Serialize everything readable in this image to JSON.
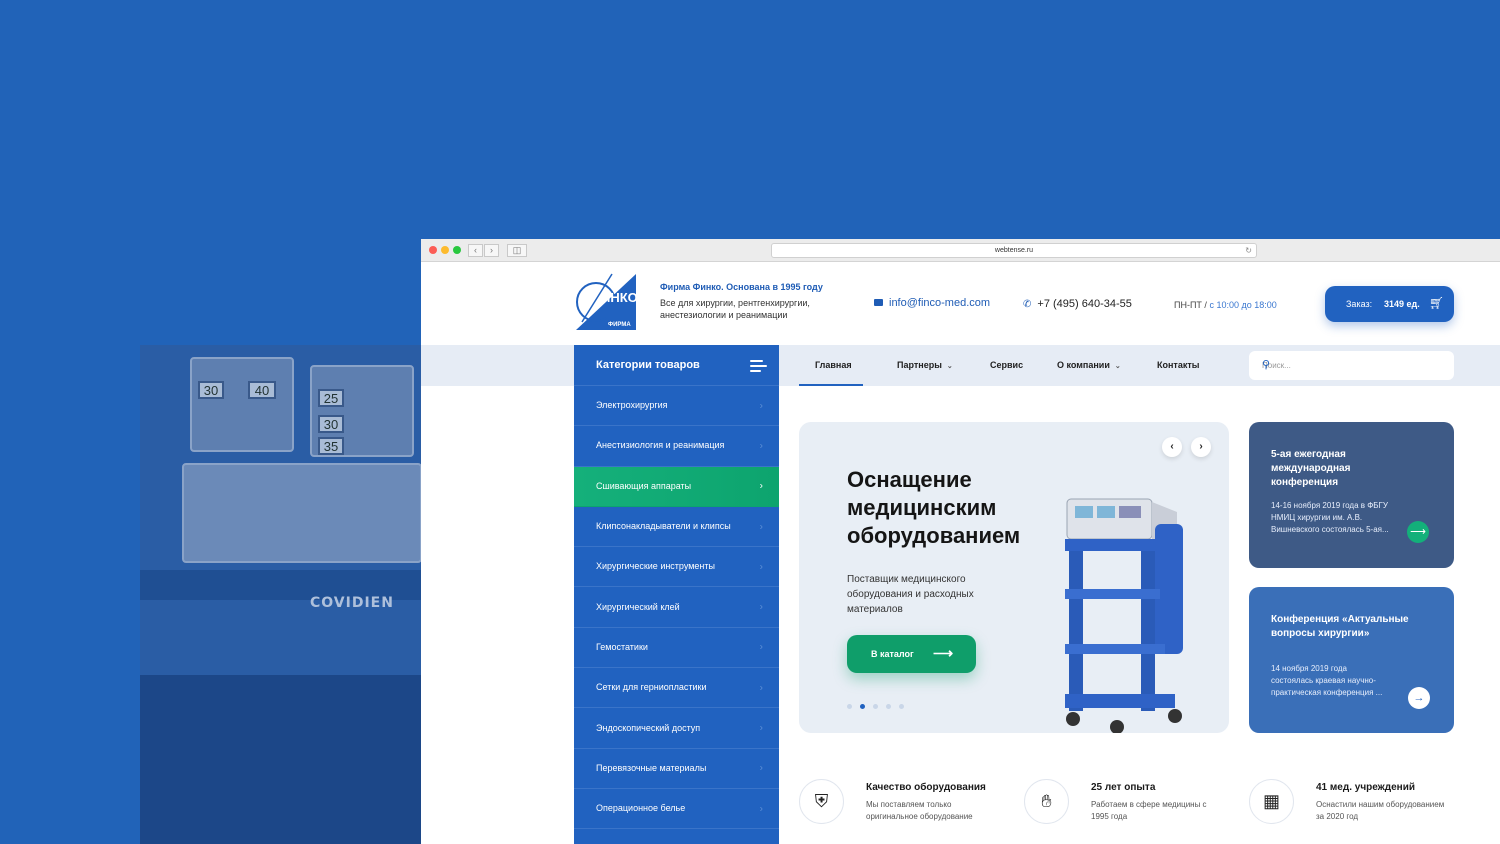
{
  "browser": {
    "url": "webtense.ru"
  },
  "header": {
    "logo_text": "ИНКО",
    "logo_sub": "ФИРМА",
    "firm_title": "Фирма Финко. Основана в 1995 году",
    "firm_desc": "Все для хирургии, рентгенхирургии, анестезиологии и реанимации",
    "email": "info@finco-med.com",
    "phone": "+7 (495) 640-34-55",
    "hours_days": "ПН-ПТ /",
    "hours_time": "с 10:00 до 18:00",
    "order_label": "Заказ:",
    "order_count": "3149 ед."
  },
  "sidebar": {
    "title": "Категории товаров",
    "items": [
      {
        "label": "Электрохирургия"
      },
      {
        "label": "Анестизиология и реанимация"
      },
      {
        "label": "Сшивающия аппараты"
      },
      {
        "label": "Клипсонакладыватели и клипсы"
      },
      {
        "label": "Хирургические инструменты"
      },
      {
        "label": "Хирургический клей"
      },
      {
        "label": "Гемостатики"
      },
      {
        "label": "Сетки для герниопластики"
      },
      {
        "label": "Эндоскопический доступ"
      },
      {
        "label": "Перевязочные материалы"
      },
      {
        "label": "Операционное белье"
      }
    ]
  },
  "nav": {
    "items": [
      {
        "label": "Главная"
      },
      {
        "label": "Партнеры"
      },
      {
        "label": "Сервис"
      },
      {
        "label": "О компании"
      },
      {
        "label": "Контакты"
      }
    ]
  },
  "search": {
    "placeholder": "Поиск..."
  },
  "hero": {
    "title": "Оснащение медицинским оборудованием",
    "text": "Поставщик медицинского оборудования и расходных материалов",
    "cta": "В каталог"
  },
  "news": [
    {
      "title": "5-ая ежегодная международная конференция",
      "text": "14-16 ноября 2019 года в ФБГУ НМИЦ хирургии им. А.В. Вишневского состоялась 5-ая..."
    },
    {
      "title": "Конференция «Актуальные вопросы хирургии»",
      "text": "14 ноября 2019 года состоялась краевая научно-практическая конференция ..."
    }
  ],
  "features": [
    {
      "title": "Качество оборудования",
      "text": "Мы поставляем только оригинальное оборудование"
    },
    {
      "title": "25 лет опыта",
      "text": "Работаем в сфере медицины с 1995 года"
    },
    {
      "title": "41 мед.  учреждений",
      "text": "Оснастили нашим оборудованием за 2020 год"
    }
  ],
  "background": {
    "brand_text": "COVIDIEN",
    "display_values": [
      "30",
      "40",
      "25",
      "30",
      "35"
    ]
  },
  "colors": {
    "accent": "#2162c0",
    "green": "#0f9e6a",
    "background": "#2163b8"
  }
}
